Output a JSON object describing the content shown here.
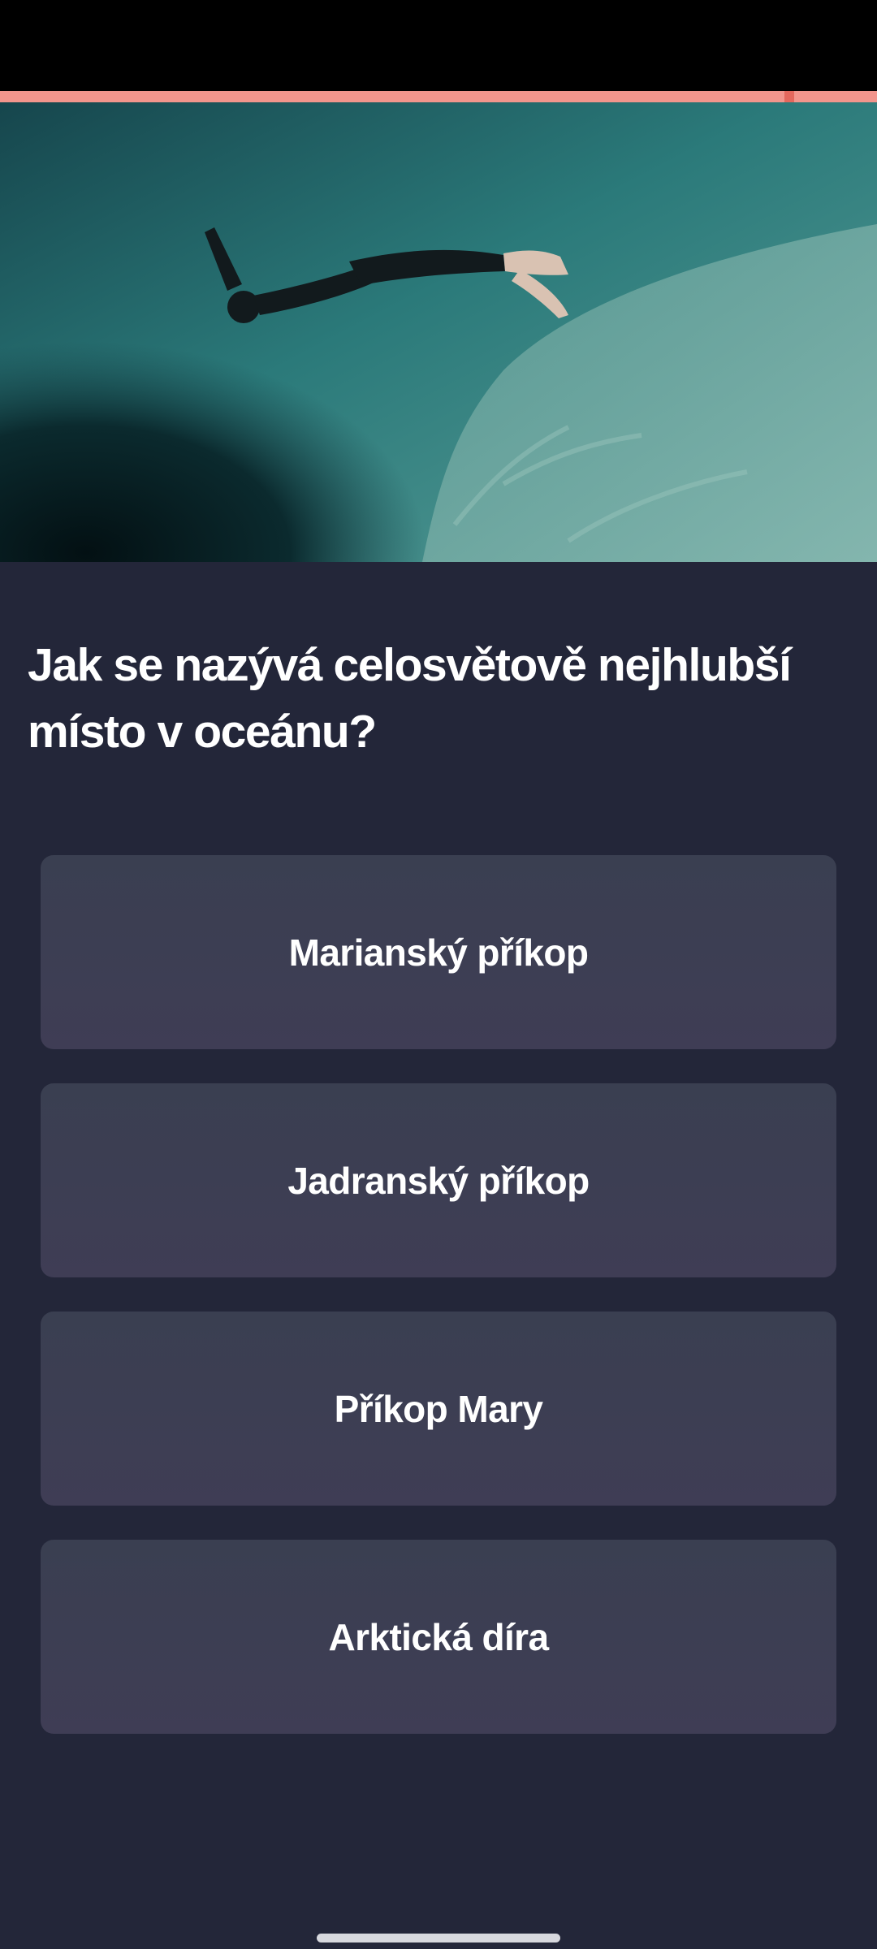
{
  "quiz": {
    "question": "Jak se nazývá celosvětově nejhlubší místo v oceánu?",
    "answers": [
      "Marianský příkop",
      "Jadranský příkop",
      "Příkop Mary",
      "Arktická díra"
    ],
    "progress_fraction": 0.9
  },
  "colors": {
    "background": "#232639",
    "progress": "#f2958c",
    "progress_marker": "#e4685d",
    "answer_button": "#3c3f53",
    "text": "#ffffff"
  },
  "hero_image": {
    "subject": "freediver swimming over an underwater abyss"
  }
}
